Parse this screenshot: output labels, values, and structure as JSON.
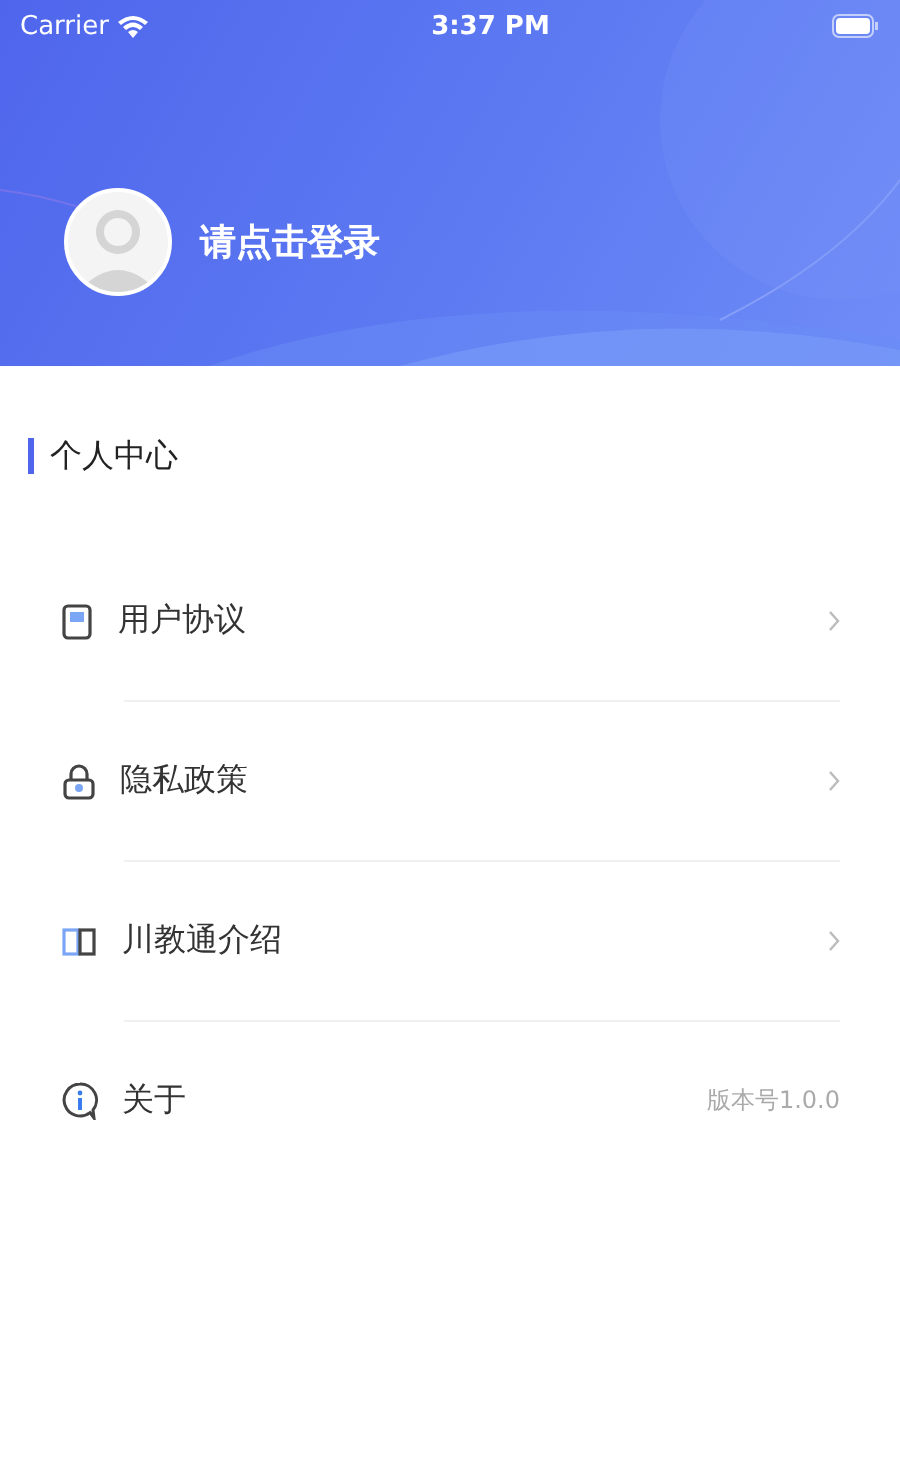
{
  "status_bar": {
    "carrier": "Carrier",
    "time": "3:37 PM"
  },
  "profile": {
    "login_prompt": "请点击登录"
  },
  "section": {
    "title": "个人中心"
  },
  "menu": [
    {
      "kind": "document",
      "label": "用户协议"
    },
    {
      "kind": "lock",
      "label": "隐私政策"
    },
    {
      "kind": "book",
      "label": "川教通介绍"
    },
    {
      "kind": "info",
      "label": "关于",
      "value": "版本号1.0.0"
    }
  ]
}
